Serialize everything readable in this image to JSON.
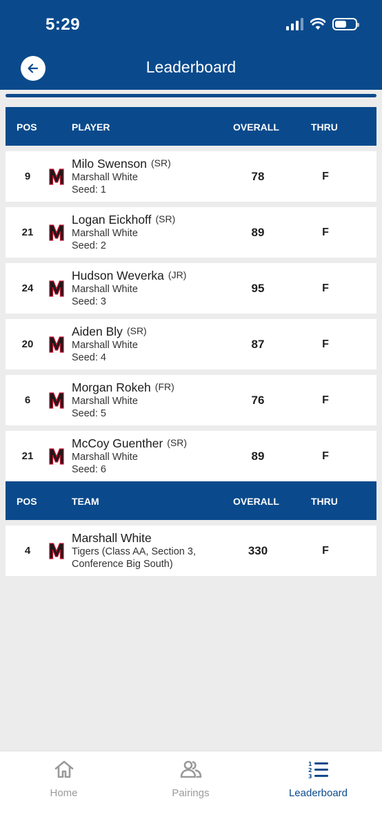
{
  "status": {
    "time": "5:29"
  },
  "nav": {
    "title": "Leaderboard"
  },
  "player_header": {
    "pos": "POS",
    "name": "PLAYER",
    "overall": "OVERALL",
    "thru": "THRU"
  },
  "players": [
    {
      "pos": "9",
      "name": "Milo Swenson",
      "class": "(SR)",
      "school": "Marshall White",
      "seed": "Seed: 1",
      "overall": "78",
      "thru": "F"
    },
    {
      "pos": "21",
      "name": "Logan Eickhoff",
      "class": "(SR)",
      "school": "Marshall White",
      "seed": "Seed: 2",
      "overall": "89",
      "thru": "F"
    },
    {
      "pos": "24",
      "name": "Hudson Weverka",
      "class": "(JR)",
      "school": "Marshall White",
      "seed": "Seed: 3",
      "overall": "95",
      "thru": "F"
    },
    {
      "pos": "20",
      "name": "Aiden Bly",
      "class": "(SR)",
      "school": "Marshall White",
      "seed": "Seed: 4",
      "overall": "87",
      "thru": "F"
    },
    {
      "pos": "6",
      "name": "Morgan Rokeh",
      "class": "(FR)",
      "school": "Marshall White",
      "seed": "Seed: 5",
      "overall": "76",
      "thru": "F"
    },
    {
      "pos": "21",
      "name": "McCoy Guenther",
      "class": "(SR)",
      "school": "Marshall White",
      "seed": "Seed: 6",
      "overall": "89",
      "thru": "F"
    }
  ],
  "team_header": {
    "pos": "POS",
    "name": "TEAM",
    "overall": "OVERALL",
    "thru": "THRU"
  },
  "team": {
    "pos": "4",
    "name": "Marshall White",
    "detail1": "Tigers (Class AA, Section 3,",
    "detail2": "Conference Big South)",
    "overall": "330",
    "thru": "F"
  },
  "tabs": [
    {
      "label": "Home",
      "icon": "home-icon",
      "active": false
    },
    {
      "label": "Pairings",
      "icon": "pairings-icon",
      "active": false
    },
    {
      "label": "Leaderboard",
      "icon": "leaderboard-icon",
      "active": true
    }
  ],
  "colors": {
    "brand": "#0a4a8c",
    "background": "#ececec",
    "logo_red": "#c8102e",
    "tab_inactive": "#9a9a9a"
  }
}
